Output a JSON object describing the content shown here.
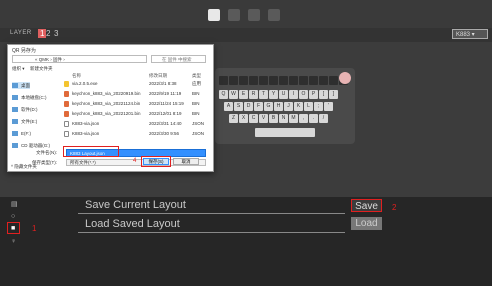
{
  "layer": {
    "label": "LAYER",
    "numbers": [
      "1",
      "2",
      "3"
    ],
    "selected": "1"
  },
  "keyboard_select": "K883",
  "dialog": {
    "title": "QR 另存为",
    "address": "« QMK › 固件 ›",
    "search_placeholder": "在 固件 中搜索",
    "toolbar_organize": "组织 ▾",
    "toolbar_newfolder": "新建文件夹",
    "sidebar": [
      "桌面",
      "本地磁盘(C:)",
      "软件(D:)",
      "文件(E:)",
      "E(F:)",
      "CD 驱动器(G:)"
    ],
    "col_name": "名称",
    "col_date": "修改日期",
    "col_type": "类型",
    "files": [
      {
        "name": "via.2.0.5.exe",
        "date": "2022/3/1 8:38",
        "type": "应用"
      },
      {
        "name": "keychron_k883_via_20220919.bin",
        "date": "2022/9/19 11:19",
        "type": "BIN"
      },
      {
        "name": "keychron_k883_via_20221124.bin",
        "date": "2022/11/24 15:19",
        "type": "BIN"
      },
      {
        "name": "keychron_k883_via_20221201.bin",
        "date": "2022/12/01 8:19",
        "type": "BIN"
      },
      {
        "name": "K883-via.json",
        "date": "2022/3/31 14:40",
        "type": "JSON"
      },
      {
        "name": "K883-via.json",
        "date": "2022/3/30 9:56",
        "type": "JSON"
      }
    ],
    "filename_label": "文件名(N):",
    "filename_value": "K883 Layout.json",
    "filetype_label": "保存类型(T):",
    "filetype_value": "所有文件(*.*)",
    "hide_folders": "^ 隐藏文件夹",
    "save_btn": "保存(S)",
    "cancel_btn": "取消"
  },
  "annotations": {
    "n1": "1",
    "n2": "2",
    "n3": "3",
    "n4": "4"
  },
  "bottom": {
    "save_layout_label": "Save Current Layout",
    "load_layout_label": "Load Saved Layout",
    "save_btn": "Save",
    "load_btn": "Load"
  },
  "keyboard_keys": [
    "Q",
    "W",
    "E",
    "R",
    "T",
    "Y",
    "U",
    "I",
    "O",
    "P",
    "[",
    "]",
    "A",
    "S",
    "D",
    "F",
    "G",
    "H",
    "J",
    "K",
    "L",
    ";",
    "'",
    "Z",
    "X",
    "C",
    "V",
    "B",
    "N",
    "M",
    ",",
    ".",
    "/"
  ],
  "colors": {
    "accent": "#e02020",
    "selection": "#3390ff"
  }
}
